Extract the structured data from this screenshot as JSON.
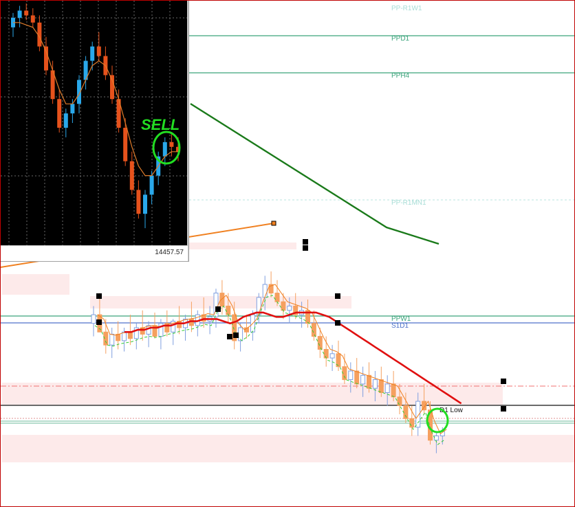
{
  "colors": {
    "bull": "#7f9fdf",
    "bear": "#f5a05f",
    "ema_red": "#e01010",
    "ma_green": "#1a7a1a",
    "fast_orange": "#f08020",
    "fast_green_dash": "#33cc33",
    "pivot_green": "#3aa37a",
    "pp_blue": "#4d72c9",
    "zone_pink": "#fdeaea",
    "annotation_green": "#22dd22",
    "inset_bull": "#2aa8ea",
    "inset_bear": "#e6521c"
  },
  "levels": [
    {
      "label": "PP-R1W1",
      "color": "#a7ddd6",
      "line": false
    },
    {
      "label": "PPD1",
      "color": "#3aa37a",
      "line": true
    },
    {
      "label": "PPH4",
      "color": "#3aa37a",
      "line": true
    },
    {
      "label": "PP-R1MN1",
      "color": "#a7ddd6",
      "line": false
    },
    {
      "label": "PPW1",
      "color": "#3aa37a",
      "line": true
    },
    {
      "label": "S1D1",
      "color": "#4d72c9",
      "line": true
    },
    {
      "label": "D1 Low",
      "color": "#111111",
      "line": true
    }
  ],
  "chart_data": [
    {
      "type": "candlestick",
      "title": "",
      "candles": [
        [
          0.62,
          0.7,
          0.56,
          0.66
        ],
        [
          0.66,
          0.76,
          0.6,
          0.58
        ],
        [
          0.58,
          0.64,
          0.48,
          0.52
        ],
        [
          0.52,
          0.6,
          0.46,
          0.57
        ],
        [
          0.57,
          0.63,
          0.5,
          0.54
        ],
        [
          0.54,
          0.6,
          0.49,
          0.58
        ],
        [
          0.58,
          0.66,
          0.52,
          0.55
        ],
        [
          0.55,
          0.62,
          0.5,
          0.6
        ],
        [
          0.6,
          0.68,
          0.54,
          0.57
        ],
        [
          0.57,
          0.63,
          0.51,
          0.61
        ],
        [
          0.61,
          0.67,
          0.55,
          0.56
        ],
        [
          0.56,
          0.64,
          0.5,
          0.62
        ],
        [
          0.62,
          0.68,
          0.56,
          0.58
        ],
        [
          0.58,
          0.64,
          0.52,
          0.63
        ],
        [
          0.63,
          0.7,
          0.57,
          0.6
        ],
        [
          0.6,
          0.66,
          0.54,
          0.64
        ],
        [
          0.64,
          0.72,
          0.58,
          0.61
        ],
        [
          0.61,
          0.68,
          0.56,
          0.66
        ],
        [
          0.66,
          0.74,
          0.6,
          0.63
        ],
        [
          0.63,
          0.7,
          0.57,
          0.65
        ],
        [
          0.65,
          0.78,
          0.6,
          0.76
        ],
        [
          0.76,
          0.82,
          0.66,
          0.7
        ],
        [
          0.7,
          0.76,
          0.62,
          0.66
        ],
        [
          0.66,
          0.72,
          0.5,
          0.54
        ],
        [
          0.54,
          0.62,
          0.49,
          0.6
        ],
        [
          0.6,
          0.66,
          0.55,
          0.58
        ],
        [
          0.58,
          0.68,
          0.54,
          0.66
        ],
        [
          0.66,
          0.76,
          0.62,
          0.74
        ],
        [
          0.74,
          0.84,
          0.68,
          0.8
        ],
        [
          0.8,
          0.86,
          0.74,
          0.76
        ],
        [
          0.76,
          0.82,
          0.7,
          0.72
        ],
        [
          0.72,
          0.76,
          0.64,
          0.68
        ],
        [
          0.68,
          0.74,
          0.62,
          0.7
        ],
        [
          0.7,
          0.76,
          0.64,
          0.66
        ],
        [
          0.66,
          0.72,
          0.6,
          0.68
        ],
        [
          0.68,
          0.73,
          0.6,
          0.62
        ],
        [
          0.62,
          0.68,
          0.54,
          0.56
        ],
        [
          0.56,
          0.6,
          0.46,
          0.5
        ],
        [
          0.5,
          0.56,
          0.42,
          0.46
        ],
        [
          0.46,
          0.52,
          0.4,
          0.48
        ],
        [
          0.48,
          0.54,
          0.4,
          0.42
        ],
        [
          0.42,
          0.48,
          0.34,
          0.36
        ],
        [
          0.36,
          0.44,
          0.3,
          0.4
        ],
        [
          0.4,
          0.46,
          0.32,
          0.34
        ],
        [
          0.34,
          0.42,
          0.28,
          0.38
        ],
        [
          0.38,
          0.44,
          0.3,
          0.32
        ],
        [
          0.32,
          0.4,
          0.26,
          0.36
        ],
        [
          0.36,
          0.42,
          0.28,
          0.3
        ],
        [
          0.3,
          0.38,
          0.24,
          0.34
        ],
        [
          0.34,
          0.4,
          0.26,
          0.28
        ],
        [
          0.28,
          0.34,
          0.2,
          0.24
        ],
        [
          0.24,
          0.3,
          0.16,
          0.18
        ],
        [
          0.18,
          0.24,
          0.1,
          0.14
        ],
        [
          0.14,
          0.3,
          0.1,
          0.26
        ],
        [
          0.26,
          0.34,
          0.2,
          0.22
        ],
        [
          0.22,
          0.26,
          0.06,
          0.08
        ],
        [
          0.08,
          0.12,
          0.02,
          0.1
        ],
        [
          0.1,
          0.14,
          0.06,
          0.12
        ]
      ],
      "ema_red": [
        0.58,
        0.58,
        0.59,
        0.59,
        0.6,
        0.6,
        0.61,
        0.61,
        0.62,
        0.62,
        0.63,
        0.63,
        0.64,
        0.64,
        0.64,
        0.63,
        0.62,
        0.63,
        0.65,
        0.66,
        0.67,
        0.67,
        0.66,
        0.65,
        0.65,
        0.66,
        0.67,
        0.67,
        0.67,
        0.67,
        0.66,
        0.65,
        0.63,
        0.61,
        0.59,
        0.57,
        0.55,
        0.53,
        0.51,
        0.49,
        0.47,
        0.45,
        0.43,
        0.41,
        0.39,
        0.37,
        0.35,
        0.33,
        0.31,
        0.29,
        0.27,
        0.25
      ],
      "ma_green": [
        0.98,
        0.96,
        0.94,
        0.92,
        0.9,
        0.88,
        0.86,
        0.84,
        0.82,
        0.8,
        0.78,
        0.76,
        0.74,
        0.72,
        0.7,
        0.68,
        0.67,
        0.66,
        0.65,
        0.64
      ]
    },
    {
      "type": "candlestick",
      "title": "",
      "price_label": "14457.57",
      "annotation": "SELL",
      "candles": [
        [
          0.9,
          0.96,
          0.86,
          0.94
        ],
        [
          0.94,
          0.99,
          0.9,
          0.97
        ],
        [
          0.97,
          1.0,
          0.93,
          0.95
        ],
        [
          0.95,
          0.98,
          0.9,
          0.92
        ],
        [
          0.92,
          0.95,
          0.8,
          0.82
        ],
        [
          0.82,
          0.86,
          0.7,
          0.72
        ],
        [
          0.72,
          0.76,
          0.58,
          0.6
        ],
        [
          0.6,
          0.64,
          0.46,
          0.48
        ],
        [
          0.48,
          0.56,
          0.44,
          0.54
        ],
        [
          0.54,
          0.6,
          0.5,
          0.58
        ],
        [
          0.58,
          0.7,
          0.54,
          0.68
        ],
        [
          0.68,
          0.78,
          0.64,
          0.76
        ],
        [
          0.76,
          0.84,
          0.72,
          0.82
        ],
        [
          0.82,
          0.88,
          0.76,
          0.78
        ],
        [
          0.78,
          0.82,
          0.68,
          0.7
        ],
        [
          0.7,
          0.74,
          0.58,
          0.6
        ],
        [
          0.6,
          0.64,
          0.46,
          0.48
        ],
        [
          0.48,
          0.52,
          0.32,
          0.34
        ],
        [
          0.34,
          0.38,
          0.2,
          0.22
        ],
        [
          0.22,
          0.26,
          0.1,
          0.12
        ],
        [
          0.12,
          0.22,
          0.06,
          0.2
        ],
        [
          0.2,
          0.3,
          0.16,
          0.28
        ],
        [
          0.28,
          0.38,
          0.24,
          0.36
        ],
        [
          0.36,
          0.44,
          0.32,
          0.42
        ],
        [
          0.42,
          0.46,
          0.36,
          0.4
        ],
        [
          0.4,
          0.44,
          0.34,
          0.38
        ]
      ],
      "ma": [
        0.92,
        0.92,
        0.91,
        0.9,
        0.86,
        0.8,
        0.72,
        0.64,
        0.58,
        0.58,
        0.62,
        0.68,
        0.74,
        0.76,
        0.74,
        0.68,
        0.6,
        0.5,
        0.4,
        0.32,
        0.28,
        0.28,
        0.32,
        0.36,
        0.38,
        0.38
      ]
    }
  ]
}
